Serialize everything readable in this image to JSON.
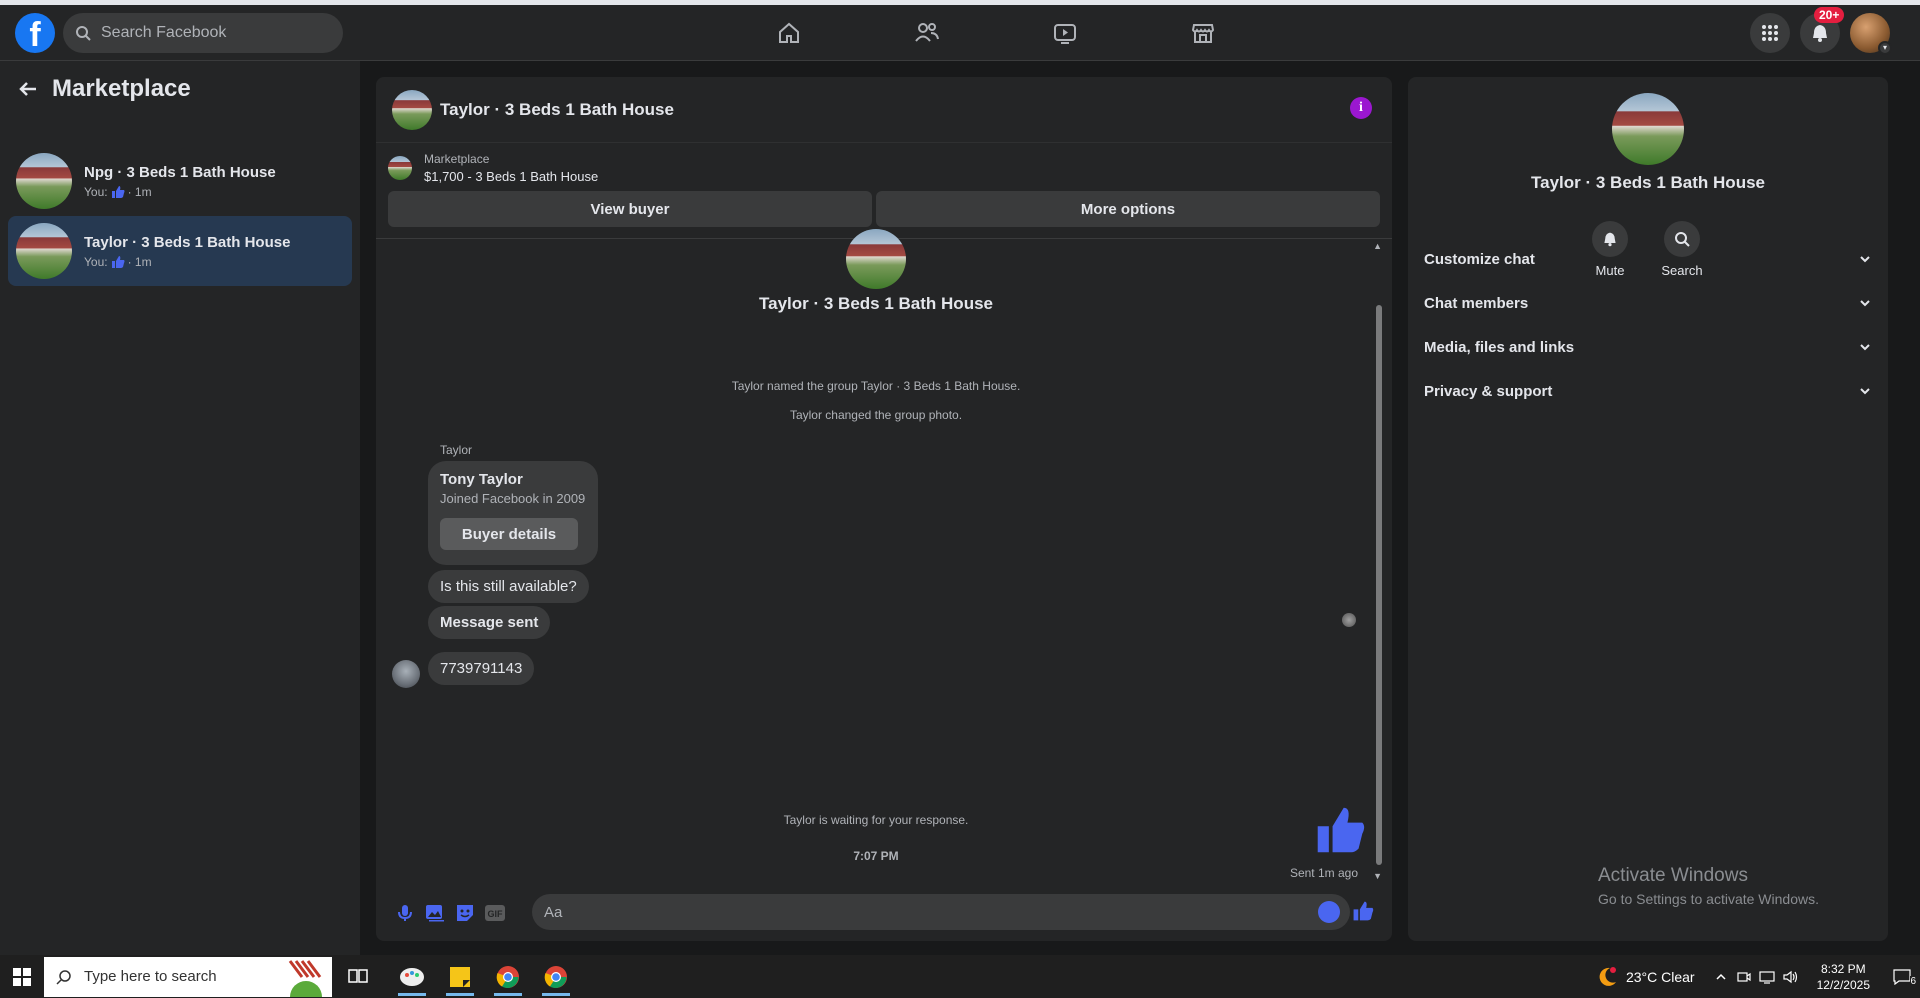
{
  "topbar": {
    "search_placeholder": "Search Facebook",
    "notification_badge": "20+"
  },
  "sidebar": {
    "title": "Marketplace",
    "conversations": [
      {
        "title": "Npg · 3 Beds 1 Bath House",
        "sub_prefix": "You:",
        "sub_time": "· 1m",
        "active": false
      },
      {
        "title": "Taylor · 3 Beds 1 Bath House",
        "sub_prefix": "You:",
        "sub_time": "· 1m",
        "active": true
      }
    ]
  },
  "chat": {
    "title": "Taylor · 3 Beds 1 Bath House",
    "marketplace_label": "Marketplace",
    "listing": "$1,700 - 3 Beds 1 Bath House",
    "view_buyer": "View buyer",
    "more_options": "More options",
    "group_name": "Taylor · 3 Beds 1 Bath House",
    "system_1": "Taylor named the group Taylor · 3 Beds 1 Bath House.",
    "system_2": "Taylor changed the group photo.",
    "sender": "Taylor",
    "card_name": "Tony Taylor",
    "card_joined": "Joined Facebook in 2009",
    "card_button": "Buyer details",
    "msg_1": "Is this still available?",
    "msg_2": "Message sent",
    "msg_3": "7739791143",
    "waiting": "Taylor is waiting for your response.",
    "time": "7:07 PM",
    "sent_status": "Sent 1m ago",
    "input_placeholder": "Aa"
  },
  "info": {
    "title": "Taylor · 3 Beds 1 Bath House",
    "mute": "Mute",
    "search": "Search",
    "sections": [
      "Customize chat",
      "Chat members",
      "Media, files and links",
      "Privacy & support"
    ],
    "watermark_1": "Activate Windows",
    "watermark_2": "Go to Settings to activate Windows."
  },
  "taskbar": {
    "search_placeholder": "Type here to search",
    "weather": "23°C  Clear",
    "time": "8:32 PM",
    "date": "12/2/2025",
    "notif_count": "6"
  },
  "colors": {
    "accent": "#4a66f0",
    "fb_blue": "#1877f2",
    "active_row": "#263951",
    "info_purple": "#9b17d0"
  }
}
